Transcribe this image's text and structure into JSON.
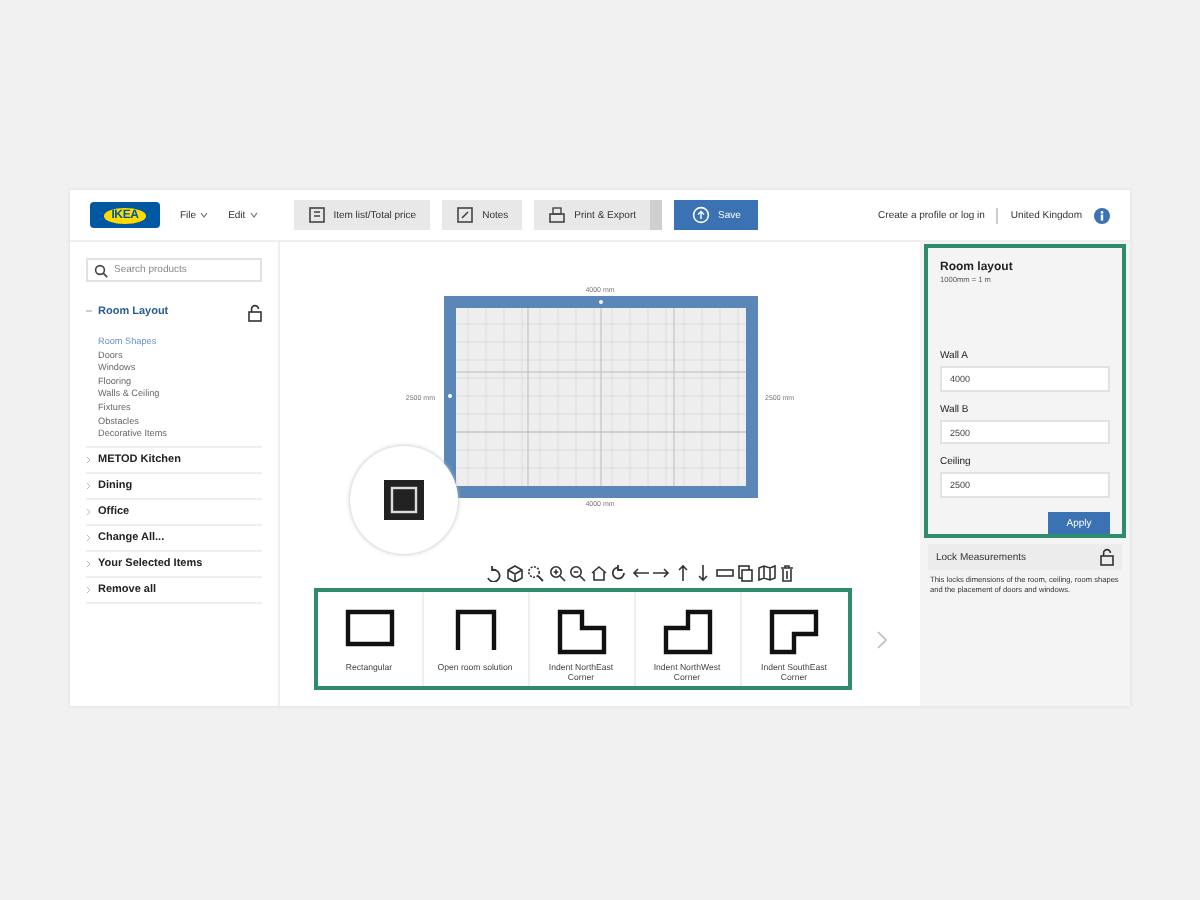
{
  "header": {
    "logo": "IKEA",
    "menus": [
      {
        "label": "File"
      },
      {
        "label": "Edit"
      }
    ],
    "buttons": [
      {
        "label": "Item list/Total price",
        "kind": "list"
      },
      {
        "label": "Notes",
        "kind": "notes"
      },
      {
        "label": "Print & Export",
        "kind": "print"
      },
      {
        "label": "Save",
        "kind": "save"
      }
    ],
    "links": [
      "Create a profile or log in",
      "United Kingdom"
    ]
  },
  "sidebar": {
    "search": {
      "placeholder": "Search products"
    },
    "sections": [
      {
        "label": "Room Layout",
        "expanded": true,
        "children": [
          {
            "label": "Room Shapes",
            "selected": true
          },
          {
            "label": "Doors",
            "selected": false
          },
          {
            "label": "Windows",
            "selected": false
          },
          {
            "label": "Flooring",
            "selected": false
          },
          {
            "label": "Walls & Ceiling",
            "selected": false
          },
          {
            "label": "Fixtures",
            "selected": false
          },
          {
            "label": "Obstacles",
            "selected": false
          },
          {
            "label": "Decorative Items",
            "selected": false
          }
        ]
      },
      {
        "label": "METOD Kitchen",
        "expanded": false
      },
      {
        "label": "Dining",
        "expanded": false
      },
      {
        "label": "Office",
        "expanded": false
      },
      {
        "label": "Change All...",
        "expanded": false
      },
      {
        "label": "Your Selected Items",
        "expanded": false
      },
      {
        "label": "Remove all",
        "expanded": false
      }
    ]
  },
  "plan": {
    "dimensions": {
      "top": "4000 mm",
      "left": "2500 mm",
      "right": "2500 mm",
      "bottom": "4000 mm"
    },
    "shapes": [
      {
        "label": "Rectangular",
        "kind": "rect"
      },
      {
        "label": "Open room solution",
        "kind": "open"
      },
      {
        "label": "Indent NorthEast Corner",
        "kind": "ne"
      },
      {
        "label": "Indent NorthWest Corner",
        "kind": "nw"
      },
      {
        "label": "Indent SouthEast Corner",
        "kind": "se"
      }
    ]
  },
  "panel": {
    "title": "Room layout",
    "scale": "1000mm = 1 m",
    "fields": [
      {
        "label": "Wall A",
        "value": "4000"
      },
      {
        "label": "Wall B",
        "value": "2500"
      },
      {
        "label": "Ceiling",
        "value": "2500"
      }
    ],
    "apply": "Apply",
    "lock_label": "Lock Measurements",
    "description": "This locks dimensions of the room, ceiling, room shapes and the placement of doors and windows."
  }
}
